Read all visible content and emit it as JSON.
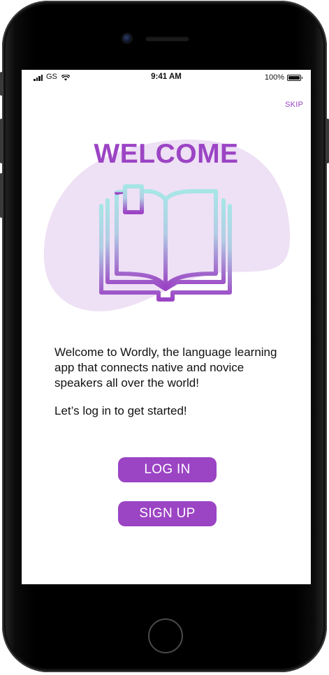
{
  "status_bar": {
    "carrier": "GS",
    "time": "9:41 AM",
    "battery": "100%",
    "battery_level": 1.0,
    "signal_bars": 4,
    "icons": [
      "signal-icon",
      "wifi-icon",
      "battery-icon"
    ]
  },
  "header": {
    "skip_label": "SKIP"
  },
  "hero": {
    "title": "WELCOME",
    "illustration_icon": "open-book-icon"
  },
  "body": {
    "intro": "Welcome to Wordly, the language learning app that connects native and novice speakers all over the world!",
    "cta": "Let’s log in to get started!"
  },
  "actions": {
    "login_label": "LOG IN",
    "signup_label": "SIGN UP"
  },
  "colors": {
    "accent": "#9b44c4",
    "blob": "#eee0f5",
    "book_gradient_top": "#a6e6e6",
    "book_gradient_bottom": "#9b44c4"
  }
}
